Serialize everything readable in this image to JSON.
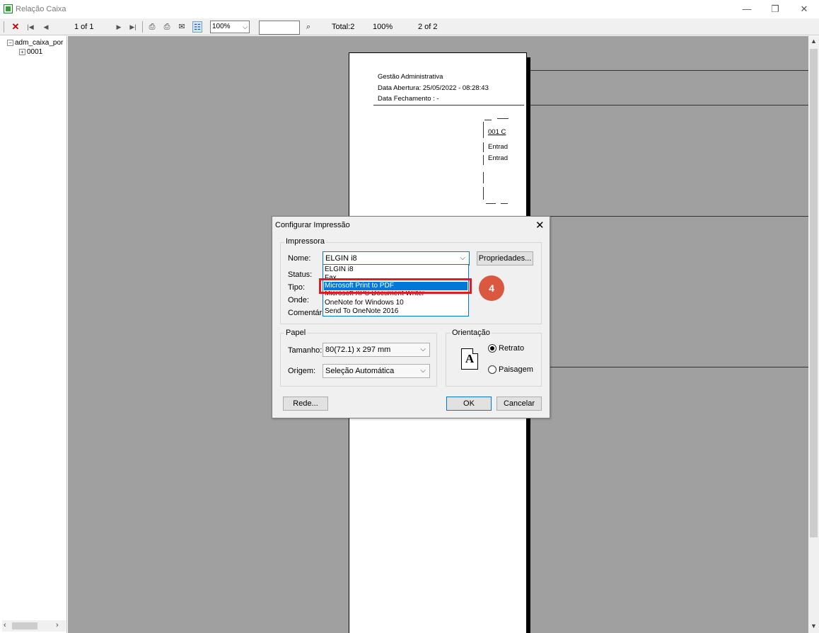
{
  "window": {
    "title": "Relação Caixa",
    "controls": [
      "—",
      "❐",
      "✕"
    ]
  },
  "toolbar": {
    "page_of": "1 of 1",
    "zoom": "100%",
    "total": "Total:2",
    "percent": "100%",
    "page_count": "2 of 2"
  },
  "tree": {
    "root": "adm_caixa_por",
    "child": "0001"
  },
  "report_page": {
    "header_lines": [
      "Gestão Administrativa",
      "Data Abertura: 25/05/2022 - 08:28:43",
      "Data Fechamento :  -"
    ],
    "fragment_lines": [
      "001  C",
      "Entrad",
      "Entrad"
    ]
  },
  "dialog": {
    "title": "Configurar Impressão",
    "printer_group": "Impressora",
    "labels": {
      "name": "Nome:",
      "status": "Status:",
      "type": "Tipo:",
      "where": "Onde:",
      "comment": "Comentário"
    },
    "printer_selected": "ELGIN i8",
    "properties_button": "Propriedades...",
    "printer_options": [
      "ELGIN i8",
      "Fax",
      "Microsoft Print to PDF",
      "Microsoft XPS Document Writer",
      "OneNote for Windows 10",
      "Send To OneNote 2016"
    ],
    "highlighted_option": "Microsoft Print to PDF",
    "paper_group": "Papel",
    "size_label": "Tamanho:",
    "size_value": "80(72.1) x 297 mm",
    "source_label": "Origem:",
    "source_value": "Seleção Automática",
    "orientation_group": "Orientação",
    "orientation_icon_letter": "A",
    "portrait_label": "Retrato",
    "landscape_label": "Paisagem",
    "portrait_selected": true,
    "network_button": "Rede...",
    "ok_button": "OK",
    "cancel_button": "Cancelar"
  },
  "annotation": {
    "step_number": "4",
    "highlight_color": "#e01b24",
    "badge_color": "#d9583f"
  }
}
